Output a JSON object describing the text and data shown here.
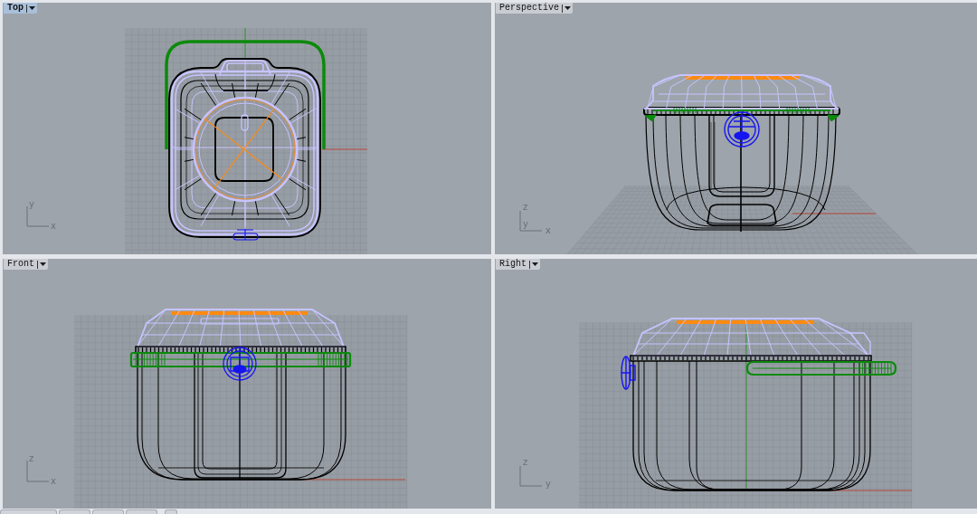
{
  "viewports": [
    {
      "kind": "top",
      "title": "Top",
      "selected": true,
      "axis_labels": [
        "y",
        "x"
      ]
    },
    {
      "kind": "perspective",
      "title": "Perspective",
      "selected": false,
      "axis_labels": [
        "z",
        "y",
        "x"
      ]
    },
    {
      "kind": "front",
      "title": "Front",
      "selected": false,
      "axis_labels": [
        "z",
        "x"
      ]
    },
    {
      "kind": "right",
      "title": "Right",
      "selected": false,
      "axis_labels": [
        "z",
        "y"
      ]
    }
  ]
}
